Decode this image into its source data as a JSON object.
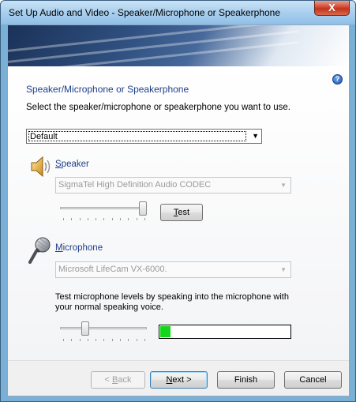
{
  "window": {
    "title": "Set Up Audio and Video - Speaker/Microphone or Speakerphone",
    "close_glyph": "X"
  },
  "help": {
    "glyph": "?"
  },
  "section": {
    "heading": "Speaker/Microphone or Speakerphone",
    "instruction": "Select the speaker/microphone or speakerphone you want to use.",
    "device_select": "Default"
  },
  "speaker": {
    "label_mnemonic": "S",
    "label_rest": "peaker",
    "device": "SigmaTel High Definition Audio CODEC",
    "volume_level": 1.0,
    "test_button": {
      "mnemonic": "T",
      "rest": "est"
    }
  },
  "microphone": {
    "label_mnemonic": "M",
    "label_rest": "icrophone",
    "device": "Microsoft LifeCam VX-6000.",
    "note": "Test microphone levels by speaking into the microphone with your normal speaking voice.",
    "gain_level": 0.27,
    "meter_level": 0.08,
    "meter_color": "#16d61b"
  },
  "footer": {
    "back": {
      "prefix": "< ",
      "mnemonic": "B",
      "rest": "ack",
      "enabled": false
    },
    "next": {
      "mnemonic": "N",
      "rest": "ext >"
    },
    "finish": "Finish",
    "cancel": "Cancel"
  },
  "colors": {
    "heading": "#1e3f8a",
    "titlebar": "#a9cfee",
    "close": "#c1331c"
  },
  "icons": {
    "speaker": "speaker-icon",
    "microphone": "microphone-icon",
    "help": "help-icon",
    "dropdown": "chevron-down-icon"
  }
}
